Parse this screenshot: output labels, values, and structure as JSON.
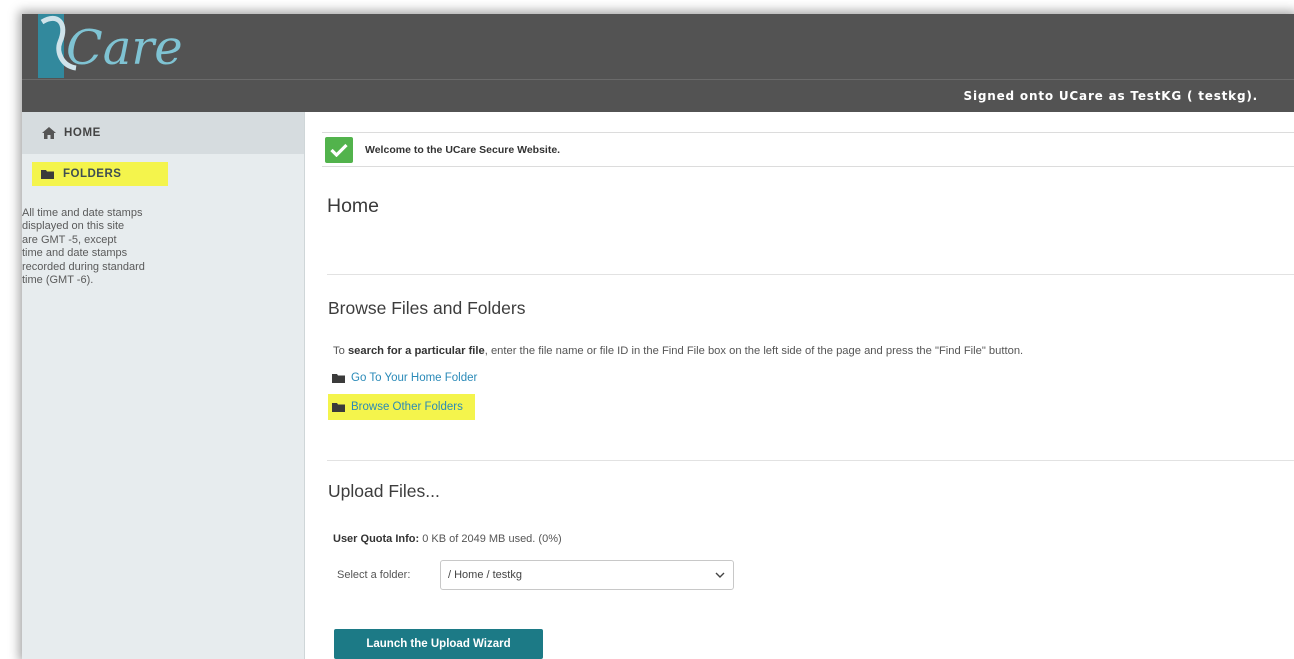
{
  "app": {
    "logo_text": "Care",
    "signed_on_prefix": "Signed onto",
    "signed_on_site": "UCare",
    "signed_on_as": "as",
    "signed_on_user": "TestKG ( testkg)."
  },
  "sidebar": {
    "home_label": "HOME",
    "folders_label": "FOLDERS",
    "timezone_note": "All time and date stamps\ndisplayed on this site\nare GMT -5, except\ntime and date stamps\nrecorded during standard\ntime (GMT -6)."
  },
  "main": {
    "welcome_text": "Welcome to the UCare Secure Website.",
    "page_title": "Home",
    "browse_heading": "Browse Files and Folders",
    "search_help_prefix": "To",
    "search_help_bold": "search for a particular file",
    "search_help_rest": ", enter the file name or file ID in the Find File box on the left side of the page and press the \"Find File\" button.",
    "home_folder_link": "Go To Your Home Folder",
    "browse_other_link": "Browse Other Folders",
    "upload_heading": "Upload Files...",
    "quota_label": "User Quota Info:",
    "quota_value": "0 KB of 2049 MB used. (0%)",
    "select_folder_label": "Select a folder:",
    "select_folder_value": "/ Home / testkg",
    "upload_button": "Launch the Upload Wizard"
  },
  "colors": {
    "topbar": "#535353",
    "sidebar": "#e7ecee",
    "highlight": "#f4f44c",
    "accent_teal": "#1c7a86",
    "link": "#2a8ab8",
    "check_green": "#52b34c"
  }
}
